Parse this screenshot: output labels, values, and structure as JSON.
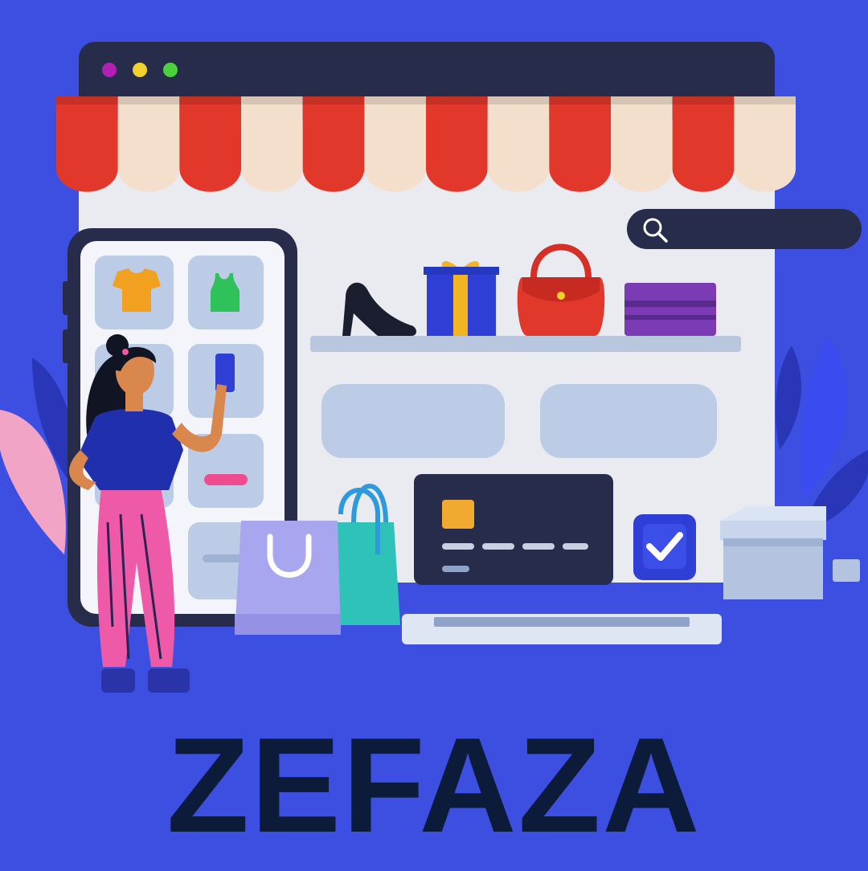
{
  "brand": {
    "name": "ZEFAZA"
  },
  "colors": {
    "background": "#3d4fe0",
    "browser_bar": "#262c4a",
    "awning_red": "#e2382c",
    "awning_cream": "#f3dfcc",
    "window_body": "#e9ebf1",
    "brand_text": "#0d1b3a",
    "dot_1": "#b11fb5",
    "dot_2": "#f2d12a",
    "dot_3": "#4ad23c"
  },
  "icons": {
    "window_controls": [
      "window-dot-purple",
      "window-dot-yellow",
      "window-dot-green"
    ],
    "search": "search-icon",
    "shelf_products": [
      "high-heel-icon",
      "gift-box-icon",
      "handbag-icon",
      "wallet-icon"
    ],
    "phone_tiles": [
      "tshirt-icon",
      "tank-top-icon",
      "phone-product-icon",
      "pill-tag-icon"
    ],
    "checkout": [
      "credit-card-icon",
      "checkmark-icon",
      "package-box-icon",
      "shopping-bag-icon",
      "keyboard-icon"
    ]
  }
}
